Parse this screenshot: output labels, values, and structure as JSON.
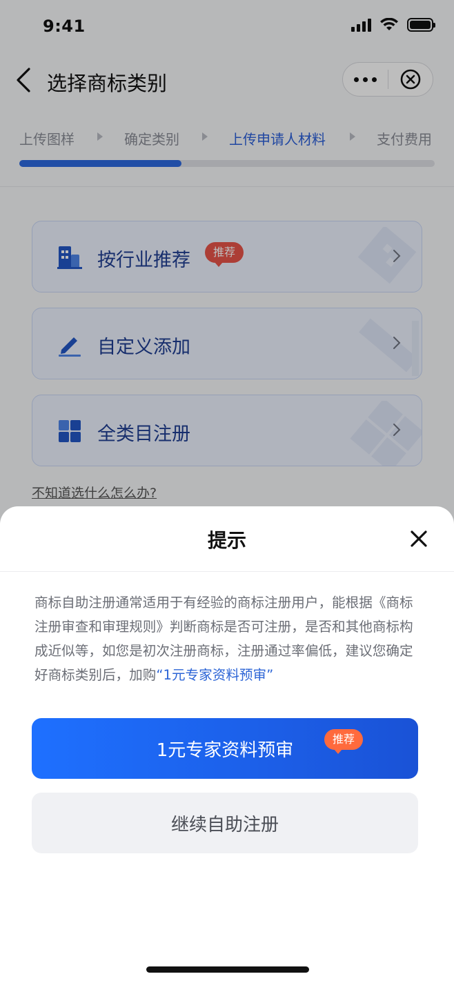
{
  "status_bar": {
    "time": "9:41"
  },
  "nav": {
    "title": "选择商标类别"
  },
  "steps": [
    {
      "label": "上传图样",
      "active": false
    },
    {
      "label": "确定类别",
      "active": false
    },
    {
      "label": "上传申请人材料",
      "active": true
    },
    {
      "label": "支付费用",
      "active": false
    }
  ],
  "progress": {
    "fraction": 0.39
  },
  "options": [
    {
      "label": "按行业推荐",
      "tag": "推荐",
      "icon": "building-icon"
    },
    {
      "label": "自定义添加",
      "icon": "pencil-icon"
    },
    {
      "label": "全类目注册",
      "icon": "grid-icon"
    }
  ],
  "help_link": "不知道选什么怎么办?",
  "sheet": {
    "title": "提示",
    "text": "商标自助注册通常适用于有经验的商标注册用户，能根据《商标注册审查和审理规则》判断商标是否可注册，是否和其他商标构成近似等，如您是初次注册商标，注册通过率偏低，建议您确定好商标类别后，加购",
    "highlight": "“1元专家资料预审”",
    "primary_button": "1元专家资料预审",
    "primary_tag": "推荐",
    "secondary_button": "继续自助注册"
  },
  "colors": {
    "primary": "#1e6bff",
    "active_step": "#2b5fd9",
    "tag_red": "#e8544a",
    "tag_orange": "#ff6a3d"
  }
}
